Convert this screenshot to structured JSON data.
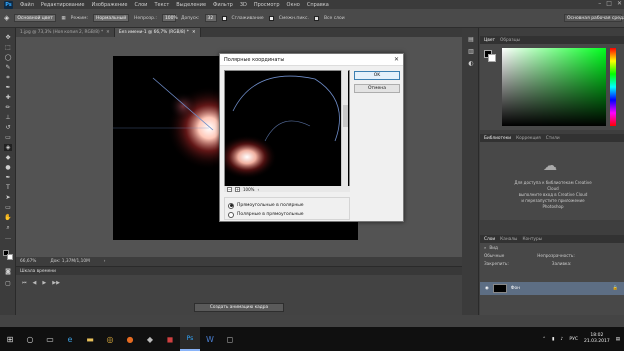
{
  "app": {
    "logo": "Ps"
  },
  "menu": [
    "Файл",
    "Редактирование",
    "Изображение",
    "Слои",
    "Текст",
    "Выделение",
    "Фильтр",
    "3D",
    "Просмотр",
    "Окно",
    "Справка"
  ],
  "options": {
    "preset": "Основной цвет",
    "mode_label": "Режим:",
    "mode_value": "Нормальный",
    "opacity_label": "Непрозр.:",
    "opacity_value": "100%",
    "tolerance_label": "Допуск:",
    "tolerance_value": "32",
    "antialias_label": "Сглаживание",
    "contiguous_label": "Смежн.пикс.",
    "all_layers_label": "Все слои",
    "workspace": "Основная рабочая среда"
  },
  "tabs": [
    {
      "label": "1.jpg @ 73,3% (Ноя копия 2, RGB/8) *",
      "active": false
    },
    {
      "label": "Без имени-1 @ 66,7% (RGB/8) *",
      "active": true
    }
  ],
  "status": {
    "zoom": "66,67%",
    "doc": "Док: 1,37M/1,10M"
  },
  "timeline": {
    "title": "Шкала времени",
    "create_button": "Создать анимацию кадра"
  },
  "panels": {
    "color_tabs": [
      "Цвет",
      "Образцы"
    ],
    "library_tabs": [
      "Библиотеки",
      "Коррекция",
      "Стили"
    ],
    "library_text": [
      "Для доступа к библиотекам Creative",
      "Cloud",
      "выполните вход в Creative Cloud",
      "и перезапустите приложение",
      "Photoshop"
    ],
    "layers_tabs": [
      "Слои",
      "Каналы",
      "Контуры"
    ],
    "kind_label": "Вид",
    "blend_mode": "Обычные",
    "opacity_label": "Непрозрачность:",
    "lock_label": "Закрепить:",
    "fill_label": "Заливка:",
    "layer_name": "Фон"
  },
  "dialog": {
    "title": "Полярные координаты",
    "ok": "OK",
    "cancel": "Отмена",
    "zoom": "100%",
    "option1": "Прямоугольные в полярные",
    "option2": "Полярные в прямоугольные",
    "selected": 0
  },
  "taskbar": {
    "lang": "РУС",
    "time": "18:02",
    "date": "21.03.2017"
  },
  "colors": {
    "accent": "#31a8ff",
    "selection": "#5d6e84",
    "taskbar": "#101010"
  }
}
